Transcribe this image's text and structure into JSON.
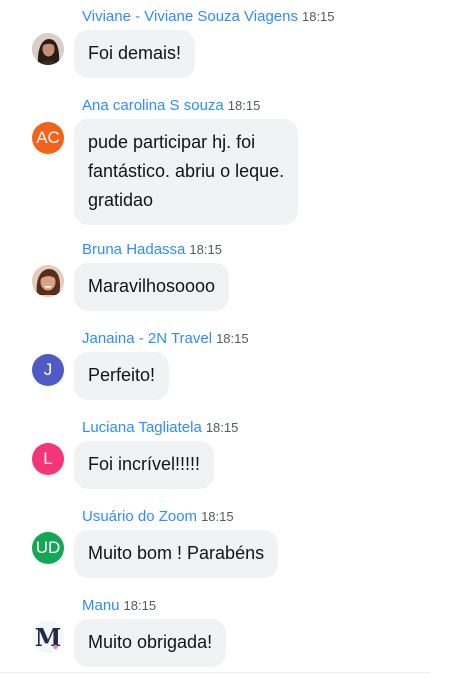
{
  "messages": [
    {
      "sender": "Viviane - Viviane Souza Viagens",
      "time": "18:15",
      "avatar": {
        "type": "photo",
        "icon": "woman-dark-hair-photo"
      },
      "text": "Foi demais!"
    },
    {
      "sender": "Ana carolina S souza",
      "time": "18:15",
      "avatar": {
        "type": "initials",
        "initials": "AC",
        "color": "#f1631b"
      },
      "lines": [
        "pude participar hj. foi",
        "fantástico. abriu o leque.",
        "gratidao"
      ]
    },
    {
      "sender": "Bruna Hadassa",
      "time": "18:15",
      "avatar": {
        "type": "photo",
        "icon": "woman-smiling-photo"
      },
      "text": "Maravilhosoooo"
    },
    {
      "sender": "Janaina - 2N Travel",
      "time": "18:15",
      "avatar": {
        "type": "initials",
        "initials": "J",
        "color": "#4f5ac6"
      },
      "text": "Perfeito!"
    },
    {
      "sender": "Luciana Tagliatela",
      "time": "18:15",
      "avatar": {
        "type": "initials",
        "initials": "L",
        "color": "#f5357a"
      },
      "text": "Foi incrível!!!!!"
    },
    {
      "sender": "Usuário do Zoom",
      "time": "18:15",
      "avatar": {
        "type": "initials",
        "initials": "UD",
        "color": "#14a855"
      },
      "text": "Muito bom ! Parabéns"
    },
    {
      "sender": "Manu",
      "time": "18:15",
      "avatar": {
        "type": "logo",
        "icon": "manu-logo-m",
        "letter": "M",
        "color": "#1f2a4d"
      },
      "text": "Muito obrigada!"
    }
  ]
}
